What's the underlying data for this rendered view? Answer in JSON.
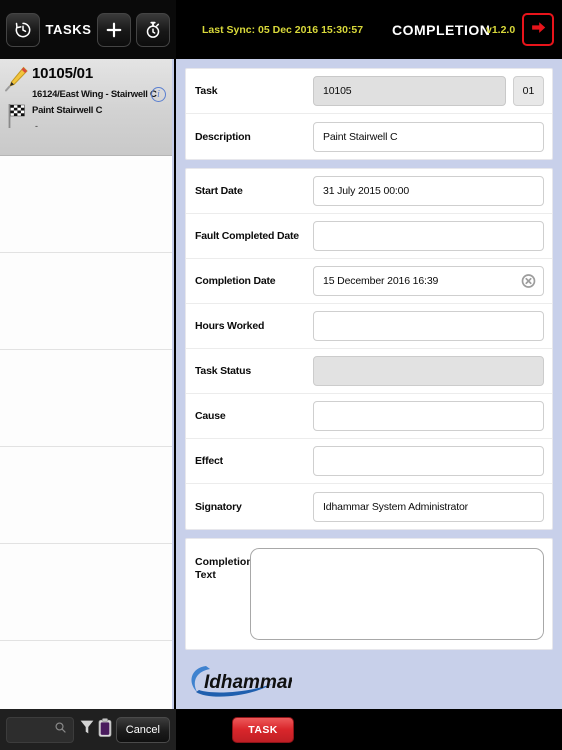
{
  "topbar": {
    "history_icon": "clock-history-icon",
    "tasks_label": "TASKS",
    "add_icon": "plus-icon",
    "timer_icon": "stopwatch-icon",
    "sync_text": "Last Sync: 05 Dec 2016 15:30:57",
    "title": "COMPLETION",
    "version": "v1.2.0",
    "exit_icon": "exit-arrow-icon",
    "sync_color": "#d8d83a",
    "exit_color": "#e8141b"
  },
  "sidebar": {
    "selected_task": {
      "id": "10105/01",
      "location": "16124/East Wing - Stairwell C",
      "description": "Paint Stairwell C",
      "dash": "-",
      "pencil_icon": "pencil-icon",
      "flag_icon": "checkered-flag-icon",
      "info_icon": "info-icon",
      "info_label": "i"
    },
    "empty_rows": 6
  },
  "form": {
    "groups": [
      {
        "rows": [
          {
            "label": "Task",
            "value": "10105",
            "style": "readonly",
            "sub": "01",
            "clear": false
          },
          {
            "label": "Description",
            "value": "Paint Stairwell C",
            "style": "normal",
            "sub": null,
            "clear": false
          }
        ]
      },
      {
        "rows": [
          {
            "label": "Start Date",
            "value": "31 July 2015 00:00",
            "style": "normal",
            "sub": null,
            "clear": false
          },
          {
            "label": "Fault Completed Date",
            "value": "",
            "style": "normal",
            "sub": null,
            "clear": false
          },
          {
            "label": "Completion Date",
            "value": "15 December 2016 16:39",
            "style": "normal",
            "sub": null,
            "clear": true
          },
          {
            "label": "Hours Worked",
            "value": "",
            "style": "normal",
            "sub": null,
            "clear": false
          },
          {
            "label": "Task Status",
            "value": "",
            "style": "shaded",
            "sub": null,
            "clear": false
          },
          {
            "label": "Cause",
            "value": "",
            "style": "normal",
            "sub": null,
            "clear": false
          },
          {
            "label": "Effect",
            "value": "",
            "style": "normal",
            "sub": null,
            "clear": false
          },
          {
            "label": "Signatory",
            "value": "Idhammar System Administrator",
            "style": "normal",
            "sub": null,
            "clear": false
          }
        ]
      }
    ],
    "completion_text": {
      "label_line1": "Completion",
      "label_line2": "Text",
      "value": ""
    },
    "clear_icon": "clear-circle-x-icon"
  },
  "logo": {
    "name": "Idhammar",
    "swoosh_color": "#2d6fc0",
    "alt": "idhammar-logo"
  },
  "bottombar": {
    "search_placeholder": "",
    "search_icon": "search-icon",
    "filter_icon": "filter-funnel-icon",
    "clipboard_icon": "clipboard-icon",
    "cancel_label": "Cancel",
    "task_label": "TASK",
    "task_color": "#d9262b"
  }
}
